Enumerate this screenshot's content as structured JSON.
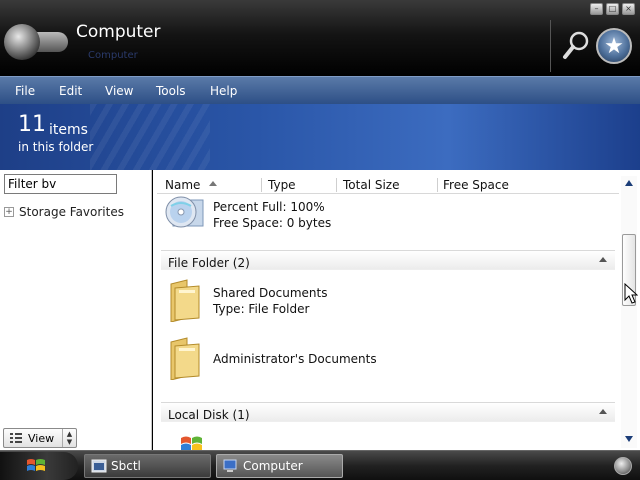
{
  "window": {
    "title": "Computer",
    "subtitle": "Computer"
  },
  "controls": [
    "minimize",
    "maximize",
    "close"
  ],
  "menu": {
    "items": [
      "File",
      "Edit",
      "View",
      "Tools",
      "Help"
    ]
  },
  "banner": {
    "count": "11",
    "count_word": "items",
    "subtitle": "in this folder"
  },
  "sidebar": {
    "filter_value": "Filter bv",
    "favorites_label": "Storage Favorites",
    "view_label": "View"
  },
  "columns": [
    "Name",
    "Type",
    "Total Size",
    "Free Space"
  ],
  "partial_item": {
    "line1": "Percent Full: 100%",
    "line2": "Free Space: 0 bytes"
  },
  "groups": [
    {
      "label": "File Folder (2)",
      "items": [
        {
          "name": "Shared Documents",
          "detail": "Type: File Folder"
        },
        {
          "name": "Administrator's Documents",
          "detail": ""
        }
      ]
    },
    {
      "label": "Local Disk (1)",
      "items": []
    }
  ],
  "taskbar": {
    "items": [
      {
        "label": "Sbctl",
        "active": false
      },
      {
        "label": "Computer",
        "active": true
      }
    ]
  },
  "colors": {
    "menubar": "#3a5e96",
    "banner": "#2a56a8",
    "accent": "#1b3d78"
  }
}
